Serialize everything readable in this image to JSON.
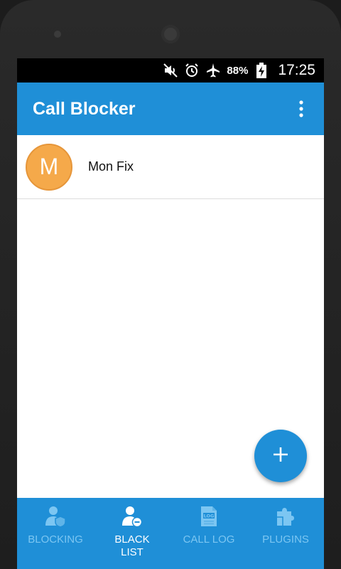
{
  "statusbar": {
    "battery_percent": "88%",
    "time": "17:25",
    "icons": [
      "muted-speaker-icon",
      "alarm-clock-icon",
      "airplane-mode-icon",
      "battery-charging-icon"
    ]
  },
  "appbar": {
    "title": "Call Blocker",
    "menu_icon": "overflow-menu-icon"
  },
  "blacklist": {
    "items": [
      {
        "initial": "M",
        "name": "Mon Fix"
      }
    ]
  },
  "fab": {
    "icon": "plus-icon"
  },
  "bottom_nav": {
    "tabs": [
      {
        "label": "BLOCKING",
        "icon": "shield-person-icon",
        "active": false
      },
      {
        "label": "BLACK\nLIST",
        "icon": "blacklist-person-icon",
        "active": true
      },
      {
        "label": "CALL LOG",
        "icon": "call-log-icon",
        "active": false
      },
      {
        "label": "PLUGINS",
        "icon": "puzzle-icon",
        "active": false
      }
    ]
  },
  "colors": {
    "primary": "#1f8fd7",
    "avatar": "#f5a94a",
    "inactive_tab": "#7cc6f2",
    "active_tab": "#ffffff"
  }
}
